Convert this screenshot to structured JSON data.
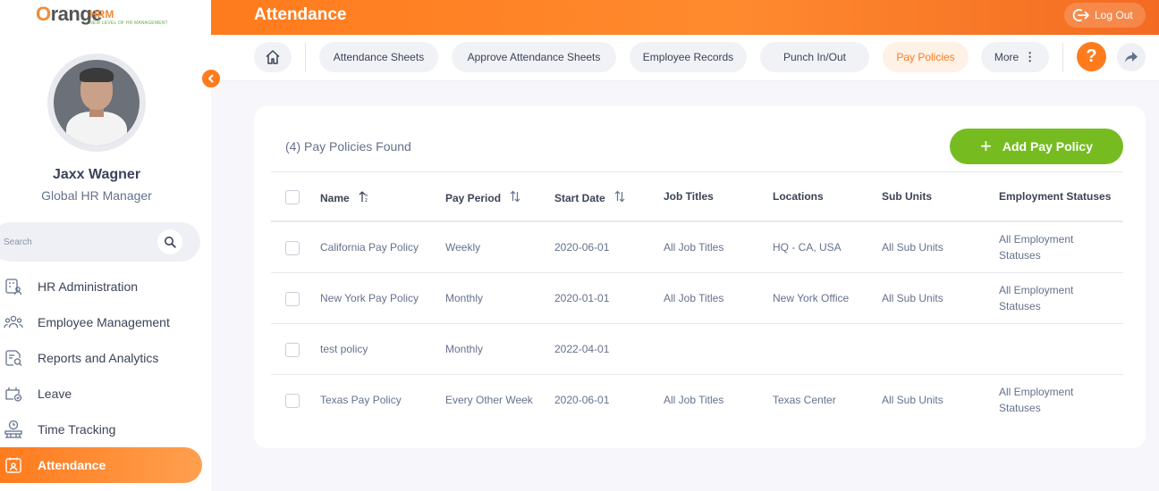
{
  "app": {
    "logo_orange": "Orange",
    "logo_hrm": "HRM",
    "logo_tagline": "NEW LEVEL OF HR MANAGEMENT"
  },
  "user": {
    "name": "Jaxx Wagner",
    "role": "Global HR Manager"
  },
  "sidebar": {
    "search_placeholder": "Search",
    "items": [
      {
        "label": "HR Administration",
        "icon": "hr-admin-icon"
      },
      {
        "label": "Employee Management",
        "icon": "employees-icon"
      },
      {
        "label": "Reports and Analytics",
        "icon": "reports-icon"
      },
      {
        "label": "Leave",
        "icon": "leave-icon"
      },
      {
        "label": "Time Tracking",
        "icon": "time-icon"
      },
      {
        "label": "Attendance",
        "icon": "attendance-icon",
        "active": true
      }
    ]
  },
  "header": {
    "title": "Attendance",
    "logout_label": "Log Out"
  },
  "tabs": [
    {
      "label": "Attendance Sheets"
    },
    {
      "label": "Approve Attendance Sheets"
    },
    {
      "label": "Employee Records"
    },
    {
      "label": "Punch In/Out"
    },
    {
      "label": "Pay Policies",
      "active": true
    },
    {
      "label": "More"
    }
  ],
  "help_label": "?",
  "main": {
    "records_found": "(4) Pay Policies Found",
    "add_button": "Add Pay Policy",
    "columns": [
      "Name",
      "Pay Period",
      "Start Date",
      "Job Titles",
      "Locations",
      "Sub Units",
      "Employment Statuses"
    ],
    "rows": [
      {
        "name": "California Pay Policy",
        "pay_period": "Weekly",
        "start_date": "2020-06-01",
        "job_titles": "All Job Titles",
        "locations": "HQ - CA, USA",
        "sub_units": "All Sub Units",
        "emp_status_1": "All Employment",
        "emp_status_2": "Statuses"
      },
      {
        "name": "New York Pay Policy",
        "pay_period": "Monthly",
        "start_date": "2020-01-01",
        "job_titles": "All Job Titles",
        "locations": "New York Office",
        "sub_units": "All Sub Units",
        "emp_status_1": "All Employment",
        "emp_status_2": "Statuses"
      },
      {
        "name": "test policy",
        "pay_period": "Monthly",
        "start_date": "2022-04-01",
        "job_titles": "",
        "locations": "",
        "sub_units": "",
        "emp_status_1": "",
        "emp_status_2": ""
      },
      {
        "name": "Texas Pay Policy",
        "pay_period": "Every Other Week",
        "start_date": "2020-06-01",
        "job_titles": "All Job Titles",
        "locations": "Texas Center",
        "sub_units": "All Sub Units",
        "emp_status_1": "All Employment",
        "emp_status_2": "Statuses"
      }
    ]
  },
  "colors": {
    "accent": "#ff7b1d",
    "add_button": "#76bc21",
    "text_dark": "#3b4357",
    "text_muted": "#64728c"
  }
}
